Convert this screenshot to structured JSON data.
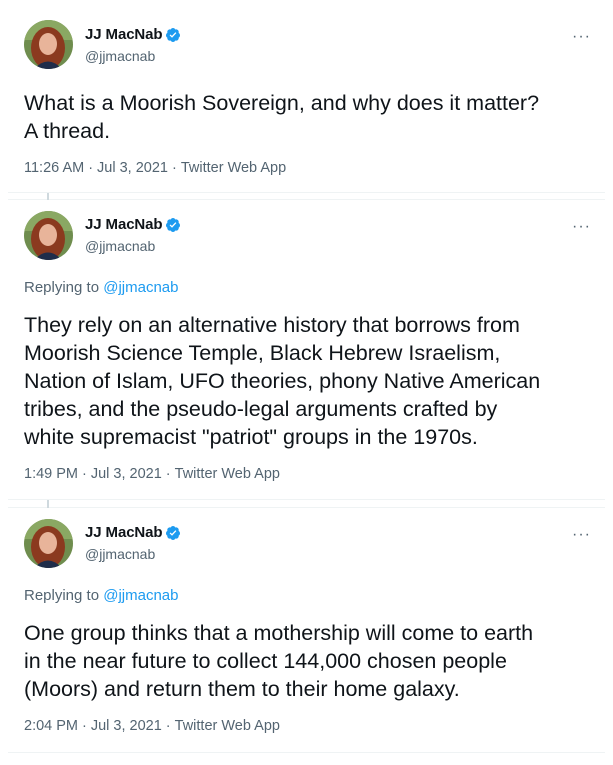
{
  "author": {
    "name": "JJ MacNab",
    "handle": "@jjmacnab"
  },
  "colors": {
    "accent": "#1d9bf0",
    "muted": "#536471",
    "text": "#0f1419"
  },
  "icons": {
    "verified": "verified-badge-icon",
    "more": "more-options-icon",
    "avatar": "avatar"
  },
  "more_glyph": "···",
  "tweets": [
    {
      "text": "What is a Moorish Sovereign, and why does it matter?\nA thread.",
      "time": "11:26 AM",
      "date": "Jul 3, 2021",
      "source": "Twitter Web App"
    },
    {
      "reply_prefix": "Replying to ",
      "reply_handle": "@jjmacnab",
      "text": "They rely on an alternative history that borrows from\nMoorish Science Temple, Black Hebrew Israelism,\nNation of Islam, UFO theories, phony Native American\ntribes, and the pseudo-legal arguments crafted by\nwhite supremacist \"patriot\" groups in the 1970s.",
      "time": "1:49 PM",
      "date": "Jul 3, 2021",
      "source": "Twitter Web App"
    },
    {
      "reply_prefix": "Replying to ",
      "reply_handle": "@jjmacnab",
      "text": "One group thinks that a mothership will come to earth\nin the near future to collect 144,000 chosen people\n(Moors) and return them to their home galaxy.",
      "time": "2:04 PM",
      "date": "Jul 3, 2021",
      "source": "Twitter Web App"
    }
  ],
  "meta_separator": "·"
}
